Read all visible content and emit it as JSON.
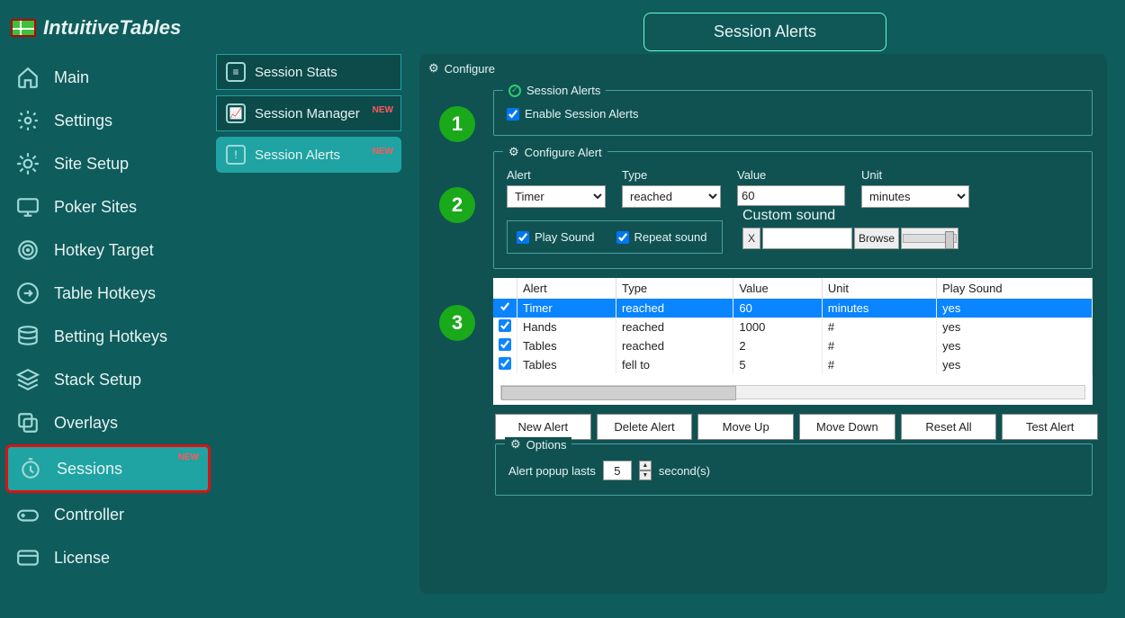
{
  "app": {
    "name": "IntuitiveTables"
  },
  "page_title": "Session Alerts",
  "sidebar": {
    "items": [
      {
        "label": "Main",
        "icon": "home"
      },
      {
        "label": "Settings",
        "icon": "gear"
      },
      {
        "label": "Site Setup",
        "icon": "cog"
      },
      {
        "label": "Poker Sites",
        "icon": "monitor"
      },
      {
        "label": "Hotkey Target",
        "icon": "target"
      },
      {
        "label": "Table Hotkeys",
        "icon": "arrow-circle"
      },
      {
        "label": "Betting Hotkeys",
        "icon": "db"
      },
      {
        "label": "Stack Setup",
        "icon": "layers"
      },
      {
        "label": "Overlays",
        "icon": "overlay"
      },
      {
        "label": "Sessions",
        "icon": "stopwatch",
        "active": true,
        "new": true,
        "highlight": true
      },
      {
        "label": "Controller",
        "icon": "gamepad"
      },
      {
        "label": "License",
        "icon": "card"
      }
    ]
  },
  "secondary": {
    "items": [
      {
        "label": "Session Stats"
      },
      {
        "label": "Session Manager",
        "new": true
      },
      {
        "label": "Session Alerts",
        "new": true,
        "active": true,
        "highlight": true
      }
    ]
  },
  "badge_new": "NEW",
  "configure": {
    "heading": "Configure",
    "session_alerts": {
      "legend": "Session Alerts",
      "enable_label": "Enable Session Alerts",
      "enable_checked": true
    },
    "configure_alert": {
      "legend": "Configure Alert",
      "labels": {
        "alert": "Alert",
        "type": "Type",
        "value": "Value",
        "unit": "Unit",
        "custom_sound": "Custom sound"
      },
      "values": {
        "alert": "Timer",
        "type": "reached",
        "value": "60",
        "unit": "minutes"
      },
      "play_sound_label": "Play Sound",
      "play_sound_checked": true,
      "repeat_sound_label": "Repeat sound",
      "repeat_sound_checked": true,
      "custom_x": "X",
      "browse": "Browse"
    }
  },
  "table": {
    "headers": [
      "Alert",
      "Type",
      "Value",
      "Unit",
      "Play Sound"
    ],
    "rows": [
      {
        "checked": true,
        "selected": true,
        "alert": "Timer",
        "type": "reached",
        "value": "60",
        "unit": "minutes",
        "play": "yes"
      },
      {
        "checked": true,
        "selected": false,
        "alert": "Hands",
        "type": "reached",
        "value": "1000",
        "unit": "#",
        "play": "yes"
      },
      {
        "checked": true,
        "selected": false,
        "alert": "Tables",
        "type": "reached",
        "value": "2",
        "unit": "#",
        "play": "yes"
      },
      {
        "checked": true,
        "selected": false,
        "alert": "Tables",
        "type": "fell to",
        "value": "5",
        "unit": "#",
        "play": "yes"
      }
    ]
  },
  "buttons": {
    "new": "New Alert",
    "delete": "Delete Alert",
    "up": "Move Up",
    "down": "Move Down",
    "reset": "Reset All",
    "test": "Test Alert"
  },
  "options": {
    "legend": "Options",
    "popup_label_pre": "Alert popup lasts",
    "popup_value": "5",
    "popup_label_post": "second(s)"
  },
  "numbers": {
    "1": "1",
    "2": "2",
    "3": "3"
  }
}
